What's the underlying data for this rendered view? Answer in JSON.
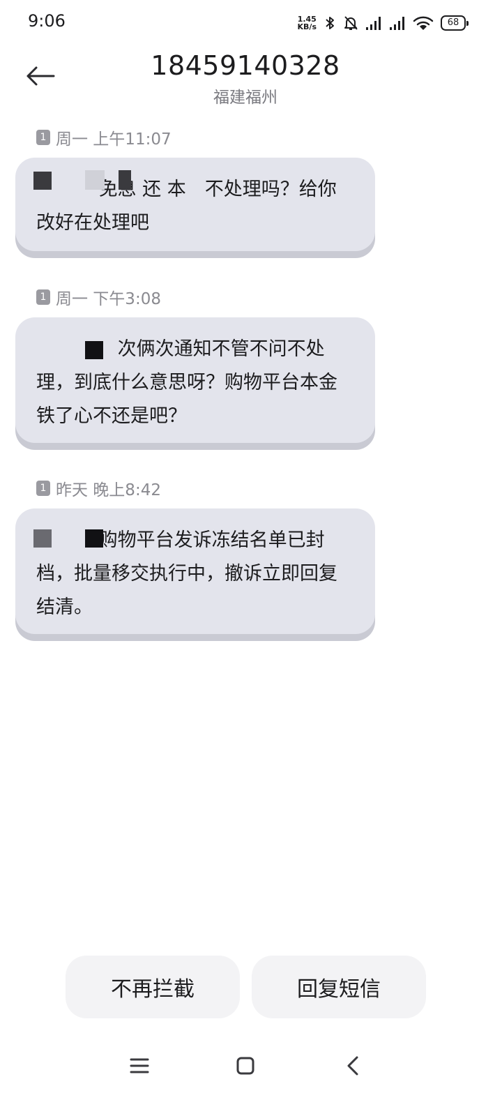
{
  "status_bar": {
    "time": "9:06",
    "net_speed_value": "1.45",
    "net_speed_unit": "KB/s",
    "battery": "68",
    "icons": [
      "bluetooth-icon",
      "mute-bell-icon",
      "signal-icon",
      "signal-icon",
      "wifi-icon",
      "battery-icon"
    ]
  },
  "header": {
    "back_icon": "arrow-left-icon",
    "contact_number": "18459140328",
    "contact_location": "福建福州"
  },
  "messages": [
    {
      "sim": "1",
      "timestamp": "周一 上午11:07",
      "text": "　　　 免息 还 本　不处理吗？给你改好在处理吧"
    },
    {
      "sim": "1",
      "timestamp": "周一 下午3:08",
      "text": "　　　　 次俩次通知不管不问不处理，到底什么意思呀？购物平台本金铁了心不还是吧？"
    },
    {
      "sim": "1",
      "timestamp": "昨天 晚上8:42",
      "text": "　　　 购物平台发诉冻结名单已封档，批量移交执行中，撤诉立即回复结清。"
    }
  ],
  "actions": {
    "unblock_label": "不再拦截",
    "reply_label": "回复短信"
  },
  "nav_bar": {
    "icons": [
      "menu-icon",
      "home-icon",
      "back-icon"
    ]
  },
  "colors": {
    "bubble": "#e3e4ec",
    "bubble_shadow": "#c9cad3",
    "button_bg": "#f3f3f5",
    "secondary_text": "#8a8a90"
  }
}
